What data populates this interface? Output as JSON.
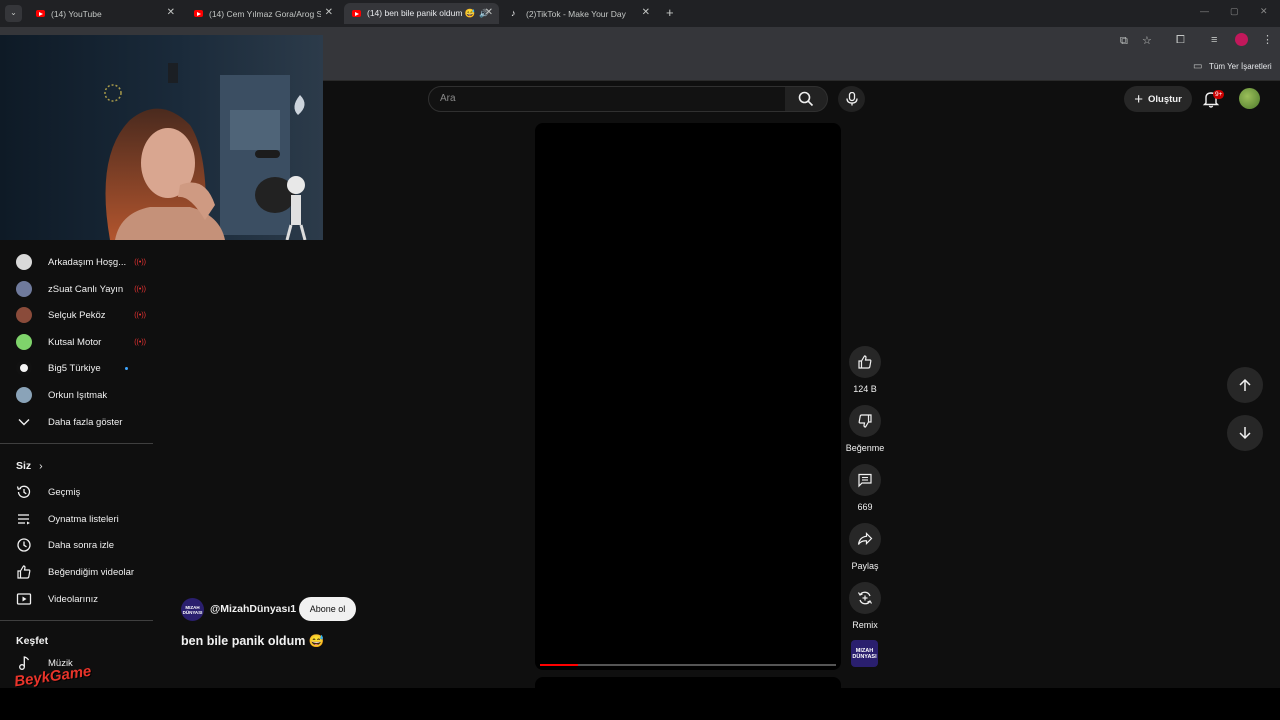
{
  "browser": {
    "tabs": [
      {
        "label": "(14) YouTube",
        "type": "youtube"
      },
      {
        "label": "(14) Cem Yılmaz Gora/Arog Sah",
        "type": "youtube"
      },
      {
        "label": "(14) ben bile panik oldum 😅",
        "type": "youtube",
        "active": true
      },
      {
        "label": "(2)TikTok - Make Your Day",
        "type": "tiktok"
      }
    ],
    "new_tab_symbol": "+",
    "bookmarks_label": "Tüm Yer İşaretleri"
  },
  "header": {
    "search_placeholder": "Ara",
    "create_label": "Oluştur",
    "notification_count": "9+"
  },
  "sidebar": {
    "subscriptions": [
      {
        "label": "Arkadaşım Hoşg...",
        "avatar_color": "#d9d9d9",
        "status": "live"
      },
      {
        "label": "zSuat Canlı Yayın",
        "avatar_color": "#6f7a9c",
        "status": "live"
      },
      {
        "label": "Selçuk Peköz",
        "avatar_color": "#8a4b3a",
        "status": "live"
      },
      {
        "label": "Kutsal Motor",
        "avatar_color": "#7fd36b",
        "status": "live"
      },
      {
        "label": "Big5 Türkiye",
        "avatar_color": "#f5f5f5",
        "status": "new"
      },
      {
        "label": "Orkun Işıtmak",
        "avatar_color": "#8aa3b8",
        "status": ""
      }
    ],
    "show_more_label": "Daha fazla göster",
    "you_section_title": "Siz",
    "you_items": [
      {
        "label": "Geçmiş",
        "icon": "history-icon"
      },
      {
        "label": "Oynatma listeleri",
        "icon": "playlist-icon"
      },
      {
        "label": "Daha sonra izle",
        "icon": "clock-icon"
      },
      {
        "label": "Beğendiğim videolar",
        "icon": "thumbs-up-icon"
      },
      {
        "label": "Videolarınız",
        "icon": "video-icon"
      }
    ],
    "explore_title": "Keşfet",
    "explore_items": [
      {
        "label": "Müzik",
        "icon": "music-icon"
      }
    ]
  },
  "short": {
    "channel_handle": "@MizahDünyası1",
    "channel_avatar_text": "MIZAH DÜNYASI",
    "subscribe_label": "Abone ol",
    "title": "ben bile panik oldum 😅",
    "progress_fraction": 0.13,
    "actions": {
      "likes": "124 B",
      "dislike_label": "Beğenme",
      "comments": "669",
      "share_label": "Paylaş",
      "remix_label": "Remix"
    }
  },
  "overlay": {
    "watermark_text": "BeykGame"
  }
}
